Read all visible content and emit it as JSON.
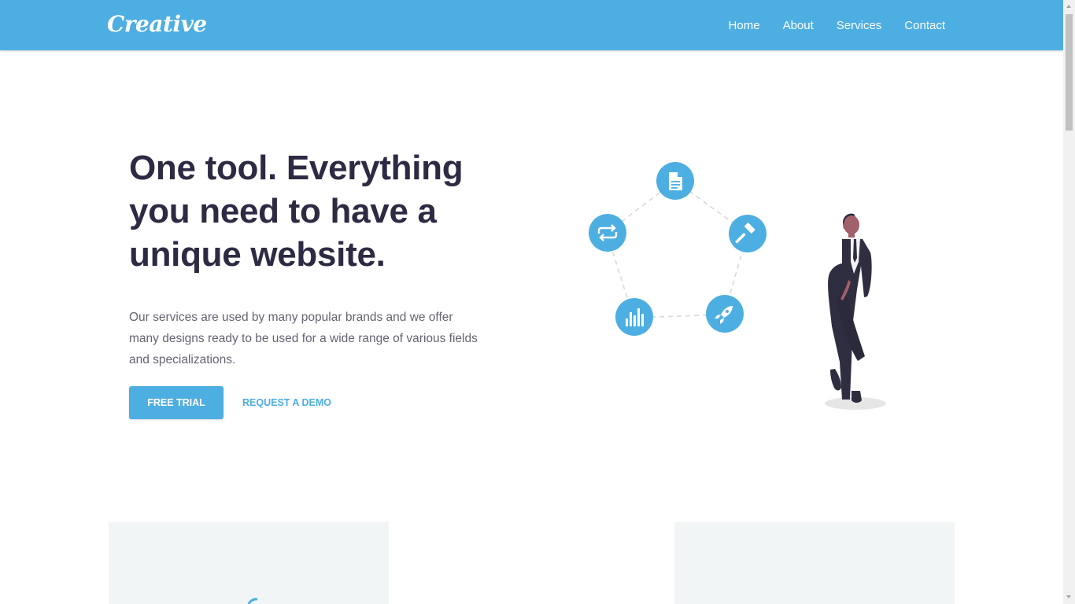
{
  "header": {
    "brand": "Creative",
    "nav": [
      "Home",
      "About",
      "Services",
      "Contact"
    ]
  },
  "hero": {
    "title": "One tool. Everything you need to have a unique website.",
    "description": "Our services are used by many popular brands and we offer many designs ready to be used for a wide range of various fields and specializations.",
    "primary_button": "FREE TRIAL",
    "secondary_link": "REQUEST A DEMO"
  },
  "illustration": {
    "icons": [
      "document-icon",
      "hammer-icon",
      "rocket-icon",
      "bar-chart-icon",
      "swap-arrows-icon"
    ]
  },
  "colors": {
    "accent": "#4daee1",
    "heading": "#2d2b43",
    "body_text": "#646473",
    "card_bg": "#f2f5f6"
  }
}
